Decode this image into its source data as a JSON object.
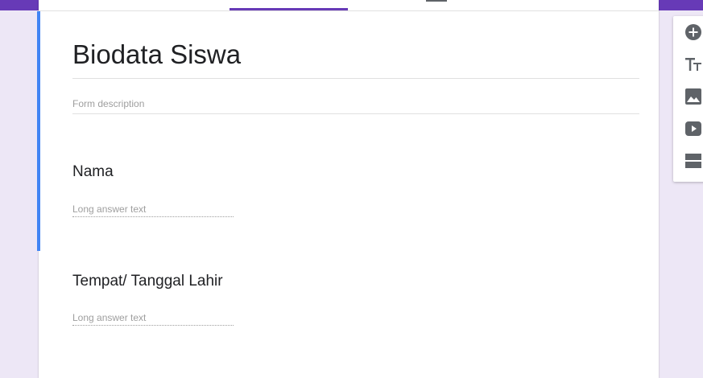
{
  "form": {
    "title": "Biodata Siswa",
    "description_placeholder": "Form description"
  },
  "questions": [
    {
      "title": "Nama",
      "answer_placeholder": "Long answer text"
    },
    {
      "title": "Tempat/ Tanggal Lahir",
      "answer_placeholder": "Long answer text"
    }
  ],
  "toolbar": {
    "items": [
      "add-question-icon",
      "add-title-icon",
      "add-image-icon",
      "add-video-icon",
      "add-section-icon"
    ]
  },
  "colors": {
    "theme": "#673ab7",
    "background": "#ede7f6",
    "focus_accent": "#4285f4",
    "icon": "#5f6368"
  }
}
